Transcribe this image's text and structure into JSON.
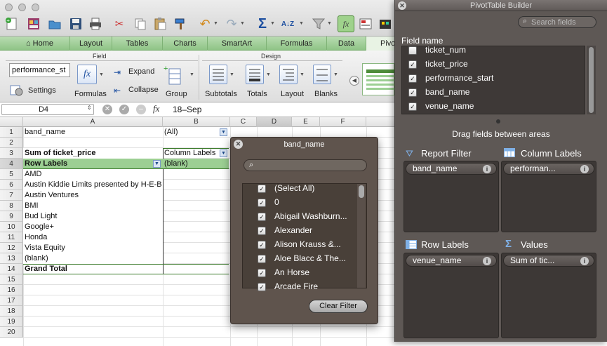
{
  "toolbar": {
    "buttons": [
      "new-icon",
      "templates-icon",
      "open-icon",
      "save-icon",
      "print-icon",
      "cut-icon",
      "copy-icon",
      "paste-icon",
      "format-painter-icon",
      "undo-icon",
      "redo-icon",
      "autosum-icon",
      "sort-icon",
      "filter-icon",
      "formula-builder-icon",
      "gallery-icon",
      "toolbox-icon"
    ]
  },
  "tabs": {
    "home": "Home",
    "layout": "Layout",
    "tables": "Tables",
    "charts": "Charts",
    "smartart": "SmartArt",
    "formulas": "Formulas",
    "data": "Data",
    "pivot": "Pivo"
  },
  "ribbon": {
    "field_group": "Field",
    "design_group": "Design",
    "field_name_value": "performance_st",
    "settings": "Settings",
    "formulas": "Formulas",
    "expand": "Expand",
    "collapse": "Collapse",
    "group": "Group",
    "subtotals": "Subtotals",
    "totals": "Totals",
    "layout": "Layout",
    "blanks": "Blanks"
  },
  "formula_bar": {
    "cell_ref": "D4",
    "fx": "fx",
    "content": "18–Sep"
  },
  "grid": {
    "columns": [
      "A",
      "B",
      "C",
      "D",
      "E",
      "F"
    ],
    "rows": [
      "1",
      "2",
      "3",
      "4",
      "5",
      "6",
      "7",
      "8",
      "9",
      "10",
      "11",
      "12",
      "13",
      "14",
      "15",
      "16",
      "17",
      "18",
      "19",
      "20"
    ],
    "a1": "band_name",
    "b1": "(All)",
    "a3": "Sum of ticket_price",
    "b3": "Column Labels",
    "a4": "Row Labels",
    "b4": "(blank)",
    "row_values": [
      "AMD",
      "Austin Kiddie Limits presented by H-E-B",
      "Austin Ventures",
      "BMI",
      "Bud Light",
      "Google+",
      "Honda",
      "Vista Equity",
      "(blank)"
    ],
    "grand_total": "Grand Total"
  },
  "filter_popup": {
    "title": "band_name",
    "search_placeholder": "",
    "items": [
      "(Select All)",
      "0",
      "Abigail Washburn...",
      "Alexander",
      "Alison Krauss &...",
      "Aloe Blacc & The...",
      "An Horse",
      "Arcade Fire"
    ],
    "clear_button": "Clear Filter"
  },
  "pivot_builder": {
    "title": "PivotTable Builder",
    "search_placeholder": "Search fields",
    "field_name_header": "Field name",
    "fields": [
      {
        "name": "ticket_num",
        "checked": false
      },
      {
        "name": "ticket_price",
        "checked": true
      },
      {
        "name": "performance_start",
        "checked": true
      },
      {
        "name": "band_name",
        "checked": true
      },
      {
        "name": "venue_name",
        "checked": true
      }
    ],
    "drag_hint": "Drag fields between areas",
    "report_filter": {
      "label": "Report Filter",
      "item": "band_name"
    },
    "column_labels": {
      "label": "Column Labels",
      "item": "performan..."
    },
    "row_labels": {
      "label": "Row Labels",
      "item": "venue_name"
    },
    "values": {
      "label": "Values",
      "item": "Sum of tic..."
    }
  },
  "colors": {
    "ribbon_tab": "#9ccf93",
    "pivot_header_fill": "#4e8c3a",
    "pivot_panel": "#5e5855",
    "popup": "#5f544d"
  }
}
